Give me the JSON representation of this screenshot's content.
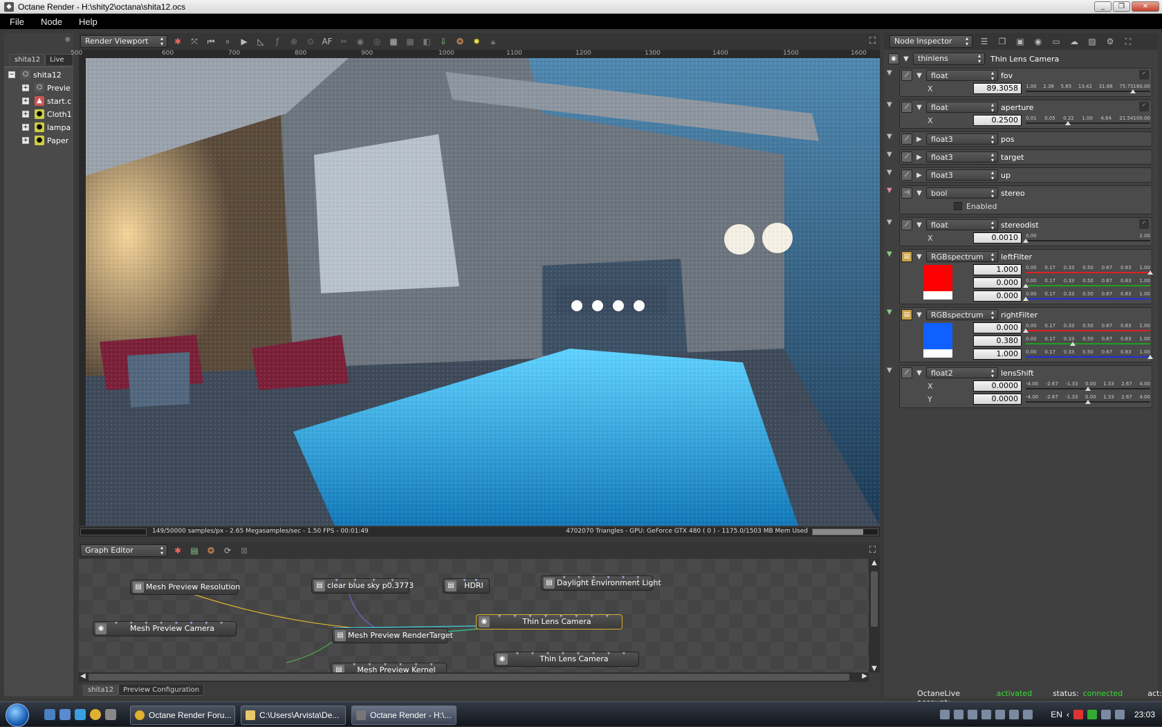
{
  "window": {
    "title": "Octane Render - H:\\shity2\\octana\\shita12.ocs"
  },
  "menu": [
    "File",
    "Node",
    "Help"
  ],
  "left_panel": {
    "tabs": [
      "shita12",
      "Live DB"
    ],
    "root": "shita12",
    "items": [
      "Previe",
      "start.c",
      "Cloth1",
      "lampa",
      "Paper"
    ]
  },
  "viewport": {
    "selector": "Render Viewport",
    "af_label": "AF",
    "ruler_ticks": [
      "500",
      "600",
      "700",
      "800",
      "900",
      "1000",
      "1100",
      "1200",
      "1300",
      "1400",
      "1500",
      "1600"
    ],
    "status_left": "149/50000 samples/px - 2.65 Megasamples/sec - 1.50 FPS - 00:01:49",
    "status_right": "4702070 Triangles - GPU: GeForce GTX 480 ( 0 ) - 1175.0/1503 MB Mem Used",
    "mem_used_fraction": 0.78
  },
  "graph_editor": {
    "selector": "Graph Editor",
    "nodes": [
      "Mesh Preview Resolution",
      "clear blue sky p0.3773",
      "HDRI",
      "Daylight Environment Light",
      "Thin Lens Camera",
      "Mesh Preview Camera",
      "Mesh Preview RenderTarget",
      "Thin Lens Camera",
      "Mesh Preview Kernel"
    ],
    "tabs": [
      "shita12",
      "Preview Configuration"
    ]
  },
  "inspector": {
    "selector": "Node Inspector",
    "root_type": "thinlens",
    "root_name": "Thin Lens Camera",
    "fov": {
      "type": "float",
      "name": "fov",
      "label": "X",
      "value": "89.3058",
      "ticks": [
        "1.00",
        "2.38",
        "5.65",
        "13.42",
        "31.88",
        "75.75180.00"
      ],
      "pos": 0.86
    },
    "aperture": {
      "type": "float",
      "name": "aperture",
      "label": "X",
      "value": "0.2500",
      "ticks": [
        "0.01",
        "0.05",
        "0.22",
        "1.00",
        "4.64",
        "21.54100.00"
      ],
      "pos": 0.34
    },
    "pos": {
      "type": "float3",
      "name": "pos"
    },
    "target": {
      "type": "float3",
      "name": "target"
    },
    "up": {
      "type": "float3",
      "name": "up"
    },
    "stereo": {
      "type": "bool",
      "name": "stereo",
      "label": "Enabled"
    },
    "stereodist": {
      "type": "float",
      "name": "stereodist",
      "label": "X",
      "value": "0.0010",
      "ticks": [
        "0.00",
        "2.00"
      ],
      "pos": 0.0
    },
    "leftFilter": {
      "type": "RGBspectrum",
      "name": "leftFilter",
      "r": "1.000",
      "g": "0.000",
      "b": "0.000",
      "color": "#ff0000"
    },
    "rightFilter": {
      "type": "RGBspectrum",
      "name": "rightFilter",
      "r": "0.000",
      "g": "0.380",
      "b": "1.000",
      "color": "#1060ff"
    },
    "spectrum_ticks": [
      "0.00",
      "0.17",
      "0.33",
      "0.50",
      "0.67",
      "0.83",
      "1.00"
    ],
    "lensShift": {
      "type": "float2",
      "name": "lensShift",
      "x_label": "X",
      "x": "0.0000",
      "y_label": "Y",
      "y": "0.0000",
      "ticks": [
        "-4.00",
        "-2.67",
        "-1.33",
        "0.00",
        "1.33",
        "2.67",
        "4.00"
      ]
    }
  },
  "status": {
    "account_label": "OctaneLive account:",
    "account_value": "activated",
    "status_label": "status:",
    "status_value": "connected",
    "act_label": "act:"
  },
  "taskbar": {
    "tasks": [
      "Octane Render Foru...",
      "C:\\Users\\Arvista\\De...",
      "Octane Render - H:\\..."
    ],
    "lang": "EN",
    "time": "23:03"
  },
  "colors": {
    "accent_green": "#33dd33",
    "red_filter": "#ff0000",
    "blue_filter": "#1060ff"
  }
}
